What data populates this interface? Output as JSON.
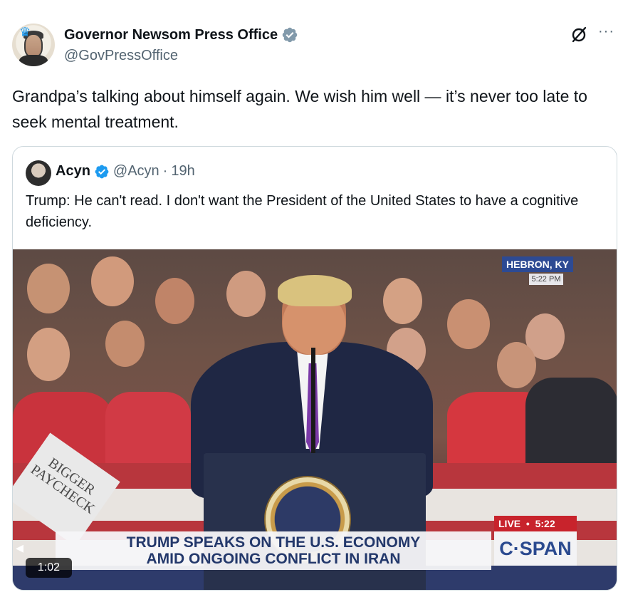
{
  "tweet": {
    "display_name": "Governor Newsom Press Office",
    "handle": "@GovPressOffice",
    "text": "Grandpa’s talking about himself again. We wish him well — it’s never too late to seek mental treatment.",
    "more_label": "···"
  },
  "quote": {
    "display_name": "Acyn",
    "handle": "@Acyn",
    "separator": "·",
    "time": "19h",
    "text": "Trump: He can't read. I don't want the President of the United States to have a cognitive deficiency.",
    "video": {
      "location": "HEBRON, KY",
      "location_time": "5:22 PM",
      "live_label": "LIVE",
      "live_time": "5:22",
      "headline_1": "TRUMP SPEAKS ON THE U.S. ECONOMY",
      "headline_2": "AMID ONGOING CONFLICT IN IRAN",
      "network": "C·SPAN",
      "duration": "1:02",
      "sign_text_1": "BIGGER",
      "sign_text_2": "PAYCHECK"
    }
  },
  "colors": {
    "verified_gray": "#829aab",
    "verified_blue": "#1d9bf0",
    "cspan_blue": "#2b4a8f",
    "live_red": "#c8232c"
  },
  "icons": {
    "avatar": "newsom-avatar",
    "verified_gray": "verified-badge-gray",
    "verified_blue": "verified-badge-blue",
    "grok": "grok-icon",
    "more": "more-icon"
  }
}
